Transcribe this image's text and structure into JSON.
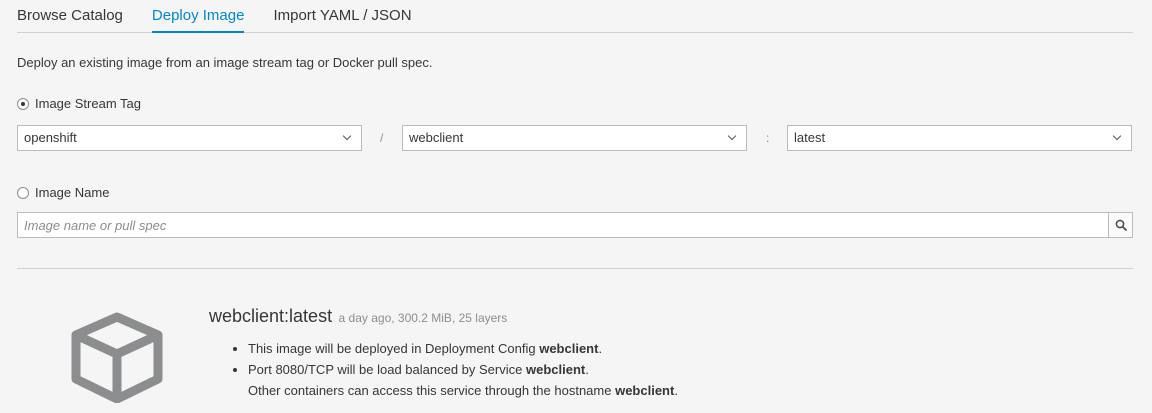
{
  "tabs": [
    {
      "label": "Browse Catalog",
      "active": false
    },
    {
      "label": "Deploy Image",
      "active": true
    },
    {
      "label": "Import YAML / JSON",
      "active": false
    }
  ],
  "intro_text": "Deploy an existing image from an image stream tag or Docker pull spec.",
  "image_stream_tag": {
    "label": "Image Stream Tag",
    "selected": true,
    "namespace": "openshift",
    "separator_1": "/",
    "image_stream": "webclient",
    "separator_2": ":",
    "tag": "latest"
  },
  "image_name": {
    "label": "Image Name",
    "selected": false,
    "placeholder": "Image name or pull spec",
    "value": ""
  },
  "image_info": {
    "name": "webclient:latest",
    "meta": "a day ago, 300.2 MiB, 25 layers",
    "bullet_1_text": "This image will be deployed in Deployment Config ",
    "bullet_1_bold": "webclient",
    "bullet_1_end": ".",
    "bullet_2_text": "Port 8080/TCP will be load balanced by Service ",
    "bullet_2_bold": "webclient",
    "bullet_2_end": ".",
    "bullet_2_line2_text": "Other containers can access this service through the hostname ",
    "bullet_2_line2_bold": "webclient",
    "bullet_2_line2_end": "."
  },
  "icons": {
    "dropdown": "chevron-down-icon",
    "search": "search-icon",
    "image": "cube-icon"
  },
  "colors": {
    "accent": "#0088ce",
    "background": "#f5f5f5",
    "cube": "#8b8d8f"
  }
}
